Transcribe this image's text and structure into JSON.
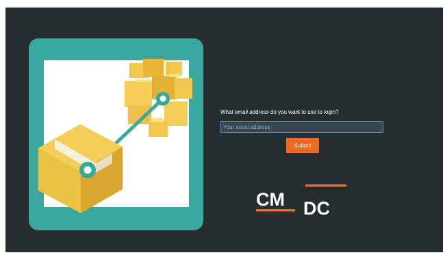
{
  "login": {
    "prompt": "What email address do you want to use to login?",
    "email_placeholder": "Your email address",
    "email_value": "",
    "submit_label": "Submit"
  },
  "logo": {
    "text_top": "CM",
    "text_bottom": "DC"
  },
  "colors": {
    "background": "#252d31",
    "accent": "#ee6a22",
    "hero_teal": "#3aa89c",
    "input_focus": "#5a98de"
  },
  "icons": [
    "packages-illustration"
  ]
}
